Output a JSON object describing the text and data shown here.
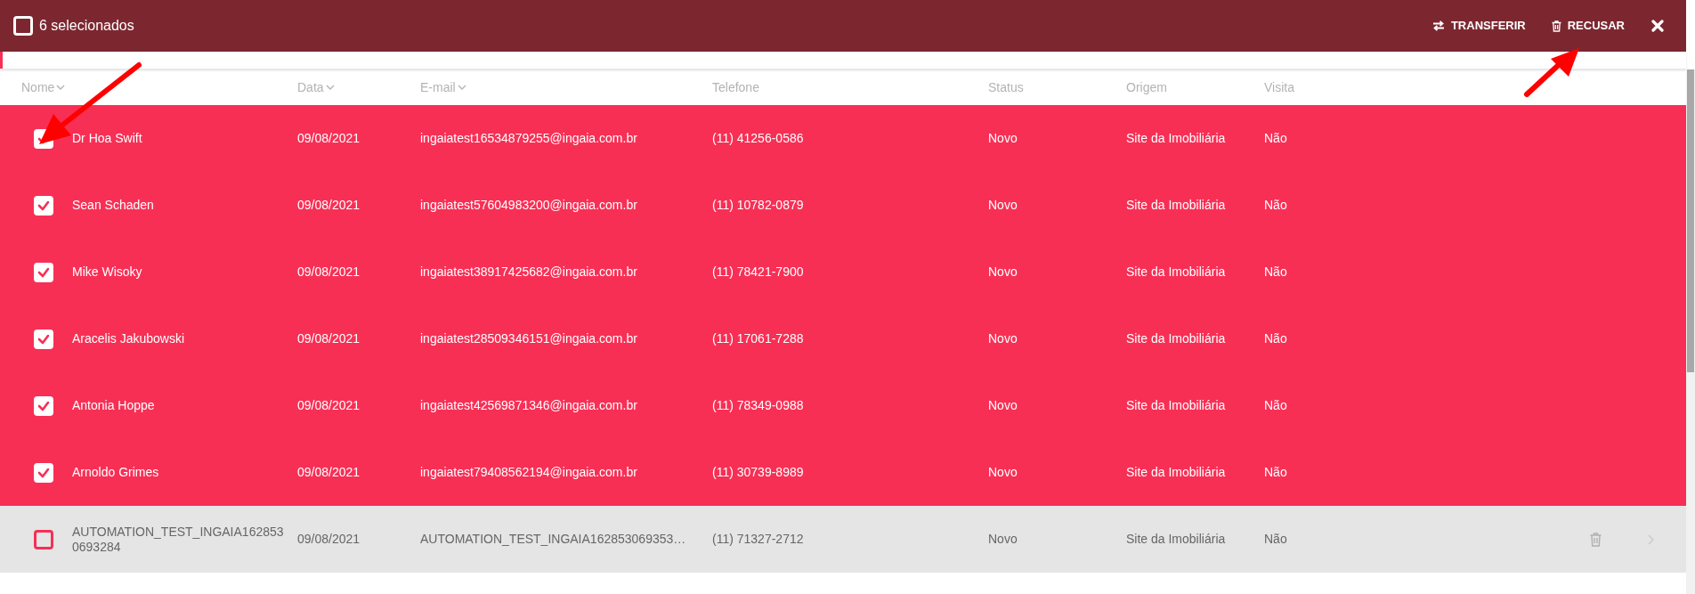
{
  "selection_bar": {
    "checkbox": {
      "checked": false
    },
    "count_label": "6 selecionados",
    "actions": [
      {
        "kind": "transfer",
        "label": "TRANSFERIR"
      },
      {
        "kind": "reject",
        "label": "RECUSAR"
      }
    ]
  },
  "table": {
    "columns": [
      {
        "label": "Nome",
        "sortable": true
      },
      {
        "label": "Data",
        "sortable": true
      },
      {
        "label": "E-mail",
        "sortable": true
      },
      {
        "label": "Telefone",
        "sortable": false
      },
      {
        "label": "Status",
        "sortable": false
      },
      {
        "label": "Origem",
        "sortable": false
      },
      {
        "label": "Visita",
        "sortable": false
      }
    ],
    "rows": [
      {
        "selected": true,
        "hovered": false,
        "cells": [
          "Dr Hoa Swift",
          "09/08/2021",
          "ingaiatest16534879255@ingaia.com.br",
          "(11) 41256-0586",
          "Novo",
          "Site da Imobiliária",
          "Não"
        ]
      },
      {
        "selected": true,
        "hovered": false,
        "cells": [
          "Sean Schaden",
          "09/08/2021",
          "ingaiatest57604983200@ingaia.com.br",
          "(11) 10782-0879",
          "Novo",
          "Site da Imobiliária",
          "Não"
        ]
      },
      {
        "selected": true,
        "hovered": false,
        "cells": [
          "Mike Wisoky",
          "09/08/2021",
          "ingaiatest38917425682@ingaia.com.br",
          "(11) 78421-7900",
          "Novo",
          "Site da Imobiliária",
          "Não"
        ]
      },
      {
        "selected": true,
        "hovered": false,
        "cells": [
          "Aracelis Jakubowski",
          "09/08/2021",
          "ingaiatest28509346151@ingaia.com.br",
          "(11) 17061-7288",
          "Novo",
          "Site da Imobiliária",
          "Não"
        ]
      },
      {
        "selected": true,
        "hovered": false,
        "cells": [
          "Antonia Hoppe",
          "09/08/2021",
          "ingaiatest42569871346@ingaia.com.br",
          "(11) 78349-0988",
          "Novo",
          "Site da Imobiliária",
          "Não"
        ]
      },
      {
        "selected": true,
        "hovered": false,
        "cells": [
          "Arnoldo Grimes",
          "09/08/2021",
          "ingaiatest79408562194@ingaia.com.br",
          "(11) 30739-8989",
          "Novo",
          "Site da Imobiliária",
          "Não"
        ]
      },
      {
        "selected": false,
        "hovered": true,
        "cells": [
          "AUTOMATION_TEST_INGAIA1628530693284",
          "09/08/2021",
          "AUTOMATION_TEST_INGAIA162853069353…",
          "(11) 71327-2712",
          "Novo",
          "Site da Imobiliária",
          "Não"
        ]
      }
    ]
  }
}
